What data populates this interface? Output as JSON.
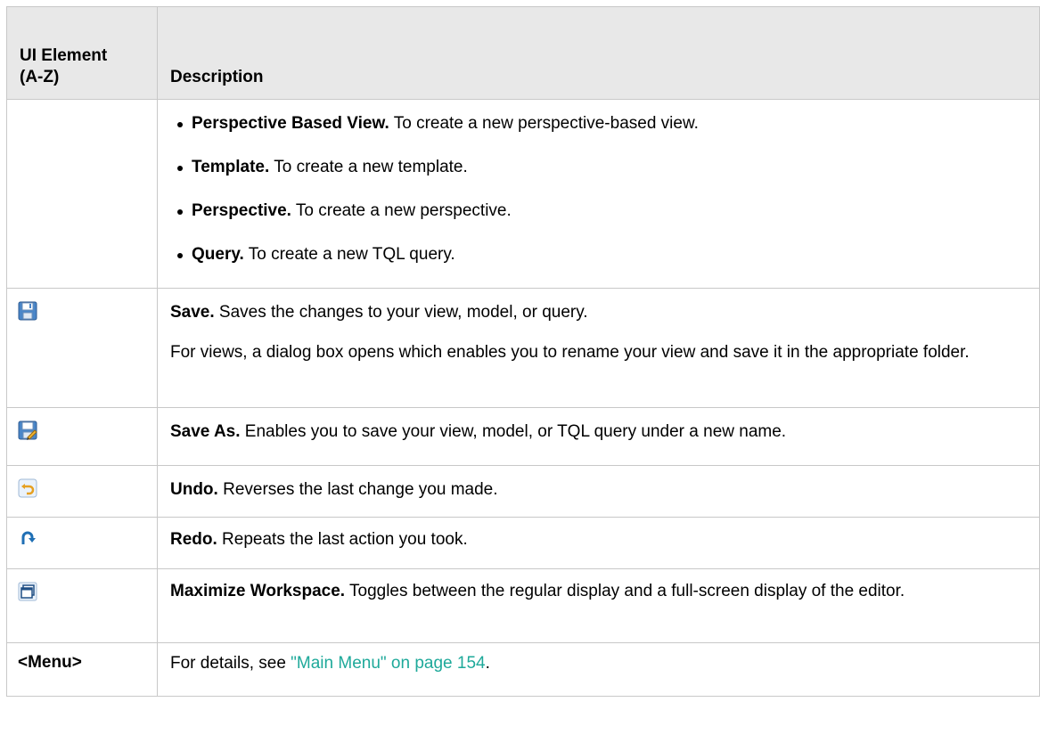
{
  "header": {
    "col1": "UI Element (A-Z)",
    "col2": "Description"
  },
  "row_new": {
    "items": [
      {
        "title": "Perspective Based View.",
        "text": " To create a new perspective-based view."
      },
      {
        "title": "Template.",
        "text": " To create a new template."
      },
      {
        "title": "Perspective.",
        "text": " To create a new perspective."
      },
      {
        "title": "Query.",
        "text": " To create a new TQL query."
      }
    ]
  },
  "row_save": {
    "icon": "save-icon",
    "title": "Save.",
    "text": " Saves the changes to your view, model, or query.",
    "para2": "For views, a dialog box opens which enables you to rename your view and save it in the appropriate folder."
  },
  "row_save_as": {
    "icon": "save-as-icon",
    "title": "Save As.",
    "text": " Enables you to save your view, model, or TQL query under a new name."
  },
  "row_undo": {
    "icon": "undo-icon",
    "title": "Undo.",
    "text": " Reverses the last change you made."
  },
  "row_redo": {
    "icon": "redo-icon",
    "title": "Redo.",
    "text": " Repeats the last action you took."
  },
  "row_maximize": {
    "icon": "maximize-workspace-icon",
    "title": "Maximize Workspace.",
    "text": " Toggles between the regular display and a full-screen display of the editor."
  },
  "row_menu": {
    "element": "<Menu>",
    "text_before": "For details, see ",
    "link": "\"Main Menu\" on page 154",
    "text_after": "."
  },
  "colors": {
    "header_bg": "#e8e8e8",
    "border": "#c8c8c8",
    "link": "#1ea99a"
  }
}
